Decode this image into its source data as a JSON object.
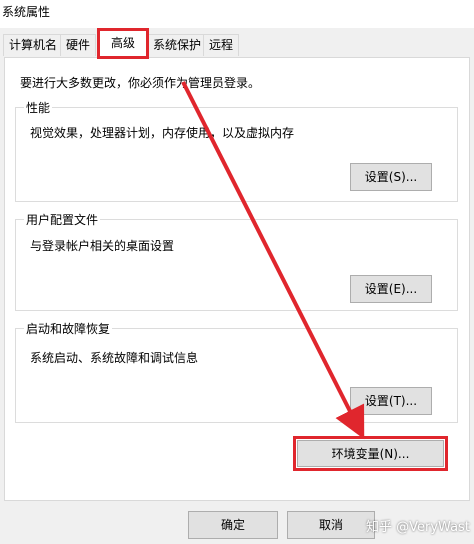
{
  "window": {
    "title": "系统属性"
  },
  "tabs": [
    {
      "label": "计算机名"
    },
    {
      "label": "硬件"
    },
    {
      "label": "高级"
    },
    {
      "label": "系统保护"
    },
    {
      "label": "远程"
    }
  ],
  "notice": "要进行大多数更改，你必须作为管理员登录。",
  "groups": {
    "performance": {
      "title": "性能",
      "desc": "视觉效果，处理器计划，内存使用，以及虚拟内存",
      "button": "设置(S)..."
    },
    "user_profiles": {
      "title": "用户配置文件",
      "desc": "与登录帐户相关的桌面设置",
      "button": "设置(E)..."
    },
    "startup_recovery": {
      "title": "启动和故障恢复",
      "desc": "系统启动、系统故障和调试信息",
      "button": "设置(T)..."
    }
  },
  "env_button": "环境变量(N)...",
  "footer": {
    "ok": "确定",
    "cancel": "取消"
  },
  "watermark": "知乎 @VeryWast",
  "colors": {
    "highlight": "#e0262d"
  }
}
